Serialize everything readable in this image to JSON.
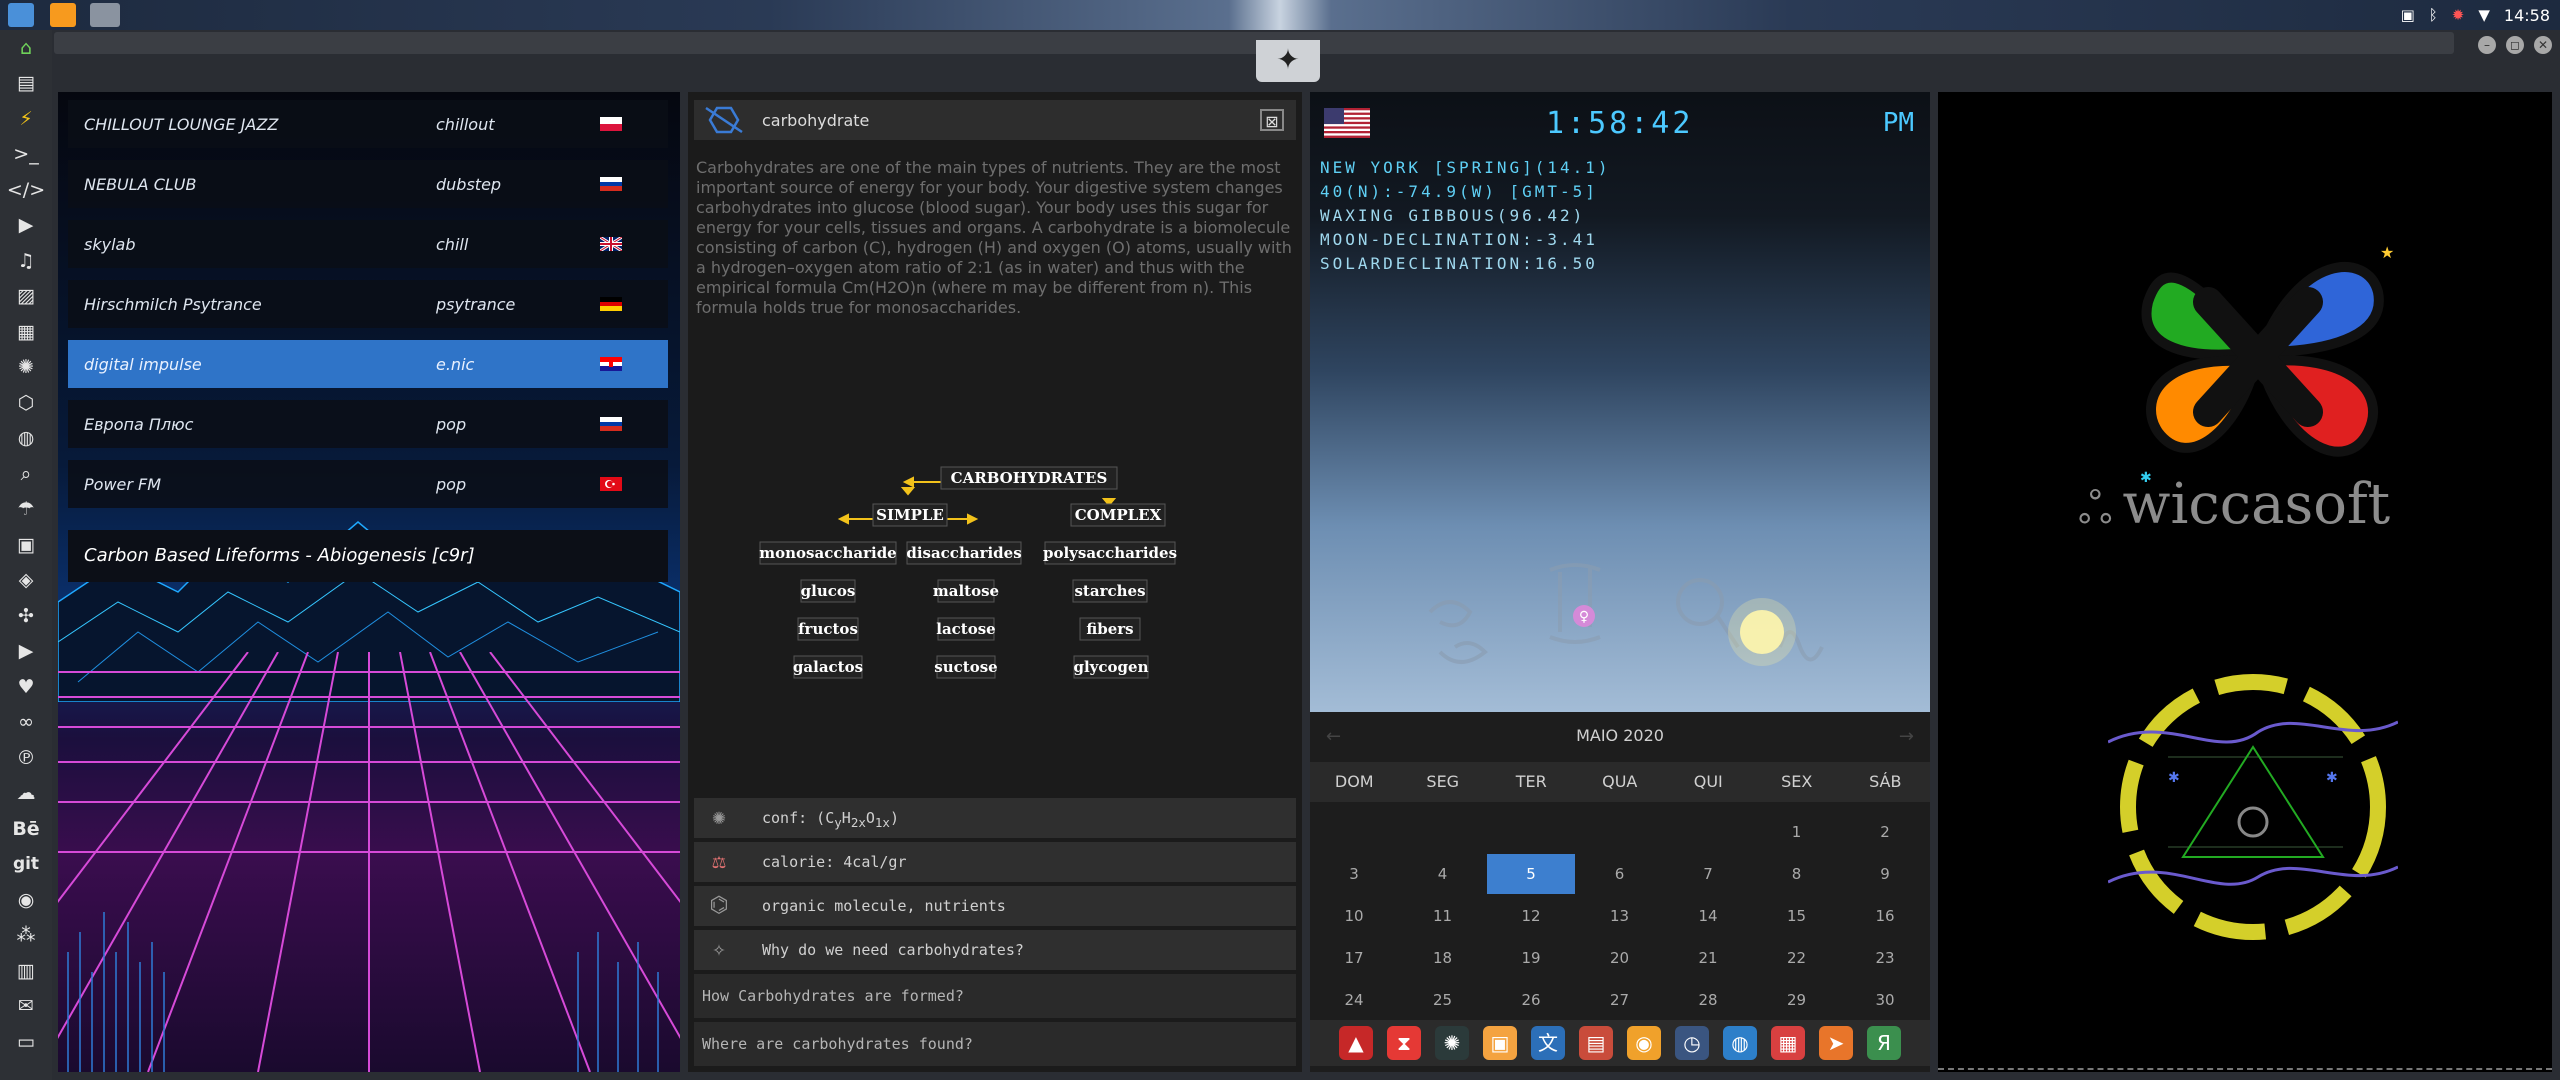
{
  "system": {
    "clock": "14:58",
    "tray_icons": [
      "photo-icon",
      "bluetooth-icon",
      "alert-icon",
      "wifi-icon"
    ]
  },
  "dock": {
    "icons": [
      "home-icon",
      "document-icon",
      "flash-icon",
      "terminal-icon",
      "code-icon",
      "play-icon",
      "music-icon",
      "image-icon",
      "news-icon",
      "rebel-icon",
      "hexagon-icon",
      "globe-icon",
      "search-icon",
      "umbrella-icon",
      "contacts-icon",
      "tag-icon",
      "puzzle-icon",
      "youtube-icon",
      "heart-icon",
      "lastfm-icon",
      "pinterest-icon",
      "cloud-icon",
      "behance-icon",
      "git-icon",
      "github-icon",
      "community-icon",
      "map-icon",
      "mail-icon",
      "message-icon"
    ],
    "text_labels": {
      "behance": "Bē",
      "git": "git"
    }
  },
  "radio": {
    "stations": [
      {
        "name": "CHILLOUT LOUNGE JAZZ",
        "genre": "chillout",
        "flag": "poland"
      },
      {
        "name": "NEBULA CLUB",
        "genre": "dubstep",
        "flag": "russia"
      },
      {
        "name": "skylab",
        "genre": "chill",
        "flag": "uk"
      },
      {
        "name": "Hirschmilch Psytrance",
        "genre": "psytrance",
        "flag": "germany"
      },
      {
        "name": "digital impulse",
        "genre": "e.nic",
        "flag": "croatia"
      },
      {
        "name": "Европа Плюс",
        "genre": "pop",
        "flag": "russia"
      },
      {
        "name": "Power FM",
        "genre": "pop",
        "flag": "turkey"
      }
    ],
    "selected_index": 4,
    "now_playing": "Carbon Based Lifeforms - Abiogenesis [c9r]"
  },
  "info": {
    "title": "carbohydrate",
    "close_label": "⊠",
    "description": "Carbohydrates are one of the main types of nutrients. They are the most important source of energy for your body. Your digestive system changes carbohydrates into glucose (blood sugar). Your body uses this sugar for energy for your cells, tissues and organs. A carbohydrate is a biomolecule consisting of carbon (C), hydrogen (H) and oxygen (O) atoms, usually with a hydrogen–oxygen atom ratio of 2:1 (as in water) and thus with the empirical formula Cm(H2O)n (where m may be different from n). This formula holds true for monosaccharides.",
    "diagram": {
      "root": "CARBOHYDRATES",
      "simple": "SIMPLE",
      "complex": "COMPLEX",
      "col1": [
        "monosaccharide",
        "glucos",
        "fructos",
        "galactos"
      ],
      "col2": [
        "disaccharides",
        "maltose",
        "lactose",
        "suctose"
      ],
      "col3": [
        "polysaccharides",
        "starches",
        "fibers",
        "glycogen"
      ]
    },
    "facts": [
      {
        "icon": "atom-icon",
        "text_prefix": "conf: (C",
        "sub1": "y",
        "mid1": "H",
        "sub2": "2x",
        "mid2": "O",
        "sub3": "1x",
        "text_suffix": ")"
      },
      {
        "icon": "scale-icon",
        "text": "calorie: 4cal/gr"
      },
      {
        "icon": "molecule-icon",
        "text": "organic molecule, nutrients"
      },
      {
        "icon": "sparkle-icon",
        "text": "Why do we need carbohydrates?"
      }
    ],
    "links": [
      "How Carbohydrates are formed?",
      "Where are carbohydrates found?"
    ]
  },
  "sky": {
    "time": "1:58:42",
    "ampm": "PM",
    "lines": [
      "NEW YORK [SPRING](14.1)",
      "40(N):-74.9(W) [GMT-5]",
      "WAXING GIBBOUS(96.42)",
      "MOON-DECLINATION:-3.41",
      "SOLARDECLINATION:16.50"
    ],
    "zodiac_glyphs": [
      "♋",
      "♊",
      "♀",
      "♌"
    ]
  },
  "calendar": {
    "month": "MAIO 2020",
    "prev": "←",
    "next": "→",
    "weekdays": [
      "DOM",
      "SEG",
      "TER",
      "QUA",
      "QUI",
      "SEX",
      "SÁB"
    ],
    "weeks": [
      [
        "",
        "",
        "",
        "",
        "",
        "1",
        "2"
      ],
      [
        "3",
        "4",
        "5",
        "6",
        "7",
        "8",
        "9"
      ],
      [
        "10",
        "11",
        "12",
        "13",
        "14",
        "15",
        "16"
      ],
      [
        "17",
        "18",
        "19",
        "20",
        "21",
        "22",
        "23"
      ],
      [
        "24",
        "25",
        "26",
        "27",
        "28",
        "29",
        "30"
      ]
    ],
    "today": "5"
  },
  "taskbar": {
    "icons": [
      "red-a-icon",
      "hourglass-icon",
      "gear-sphere-icon",
      "image-viewer-icon",
      "translate-icon",
      "presentation-icon",
      "search-app-icon",
      "clock-app-icon",
      "browser-icon",
      "calendar-app-icon",
      "arrow-app-icon",
      "yandex-icon"
    ],
    "glyphs": [
      "▲",
      "⧗",
      "✺",
      "▣",
      "文",
      "▤",
      "◉",
      "◷",
      "◍",
      "▦",
      "➤",
      "Я"
    ],
    "colors": [
      "#c62828",
      "#e53935",
      "#2b3a3a",
      "#f4a340",
      "#2c6fb8",
      "#c94c3b",
      "#f0a12b",
      "#3a5580",
      "#2d7fc9",
      "#d84040",
      "#e8752a",
      "#3b8f4e"
    ]
  },
  "wicca": {
    "brand": "wiccasoft",
    "petal_colors": {
      "green": "#22aa22",
      "blue": "#2f65d8",
      "orange": "#ff8a00",
      "red": "#e02020"
    },
    "ring_color": "#d4cf2a"
  },
  "colors": {
    "accent_blue": "#2f74c8",
    "clock_cyan": "#4cc9ff",
    "today_blue": "#3d7fcf",
    "diagram_yellow": "#f2c21b"
  }
}
